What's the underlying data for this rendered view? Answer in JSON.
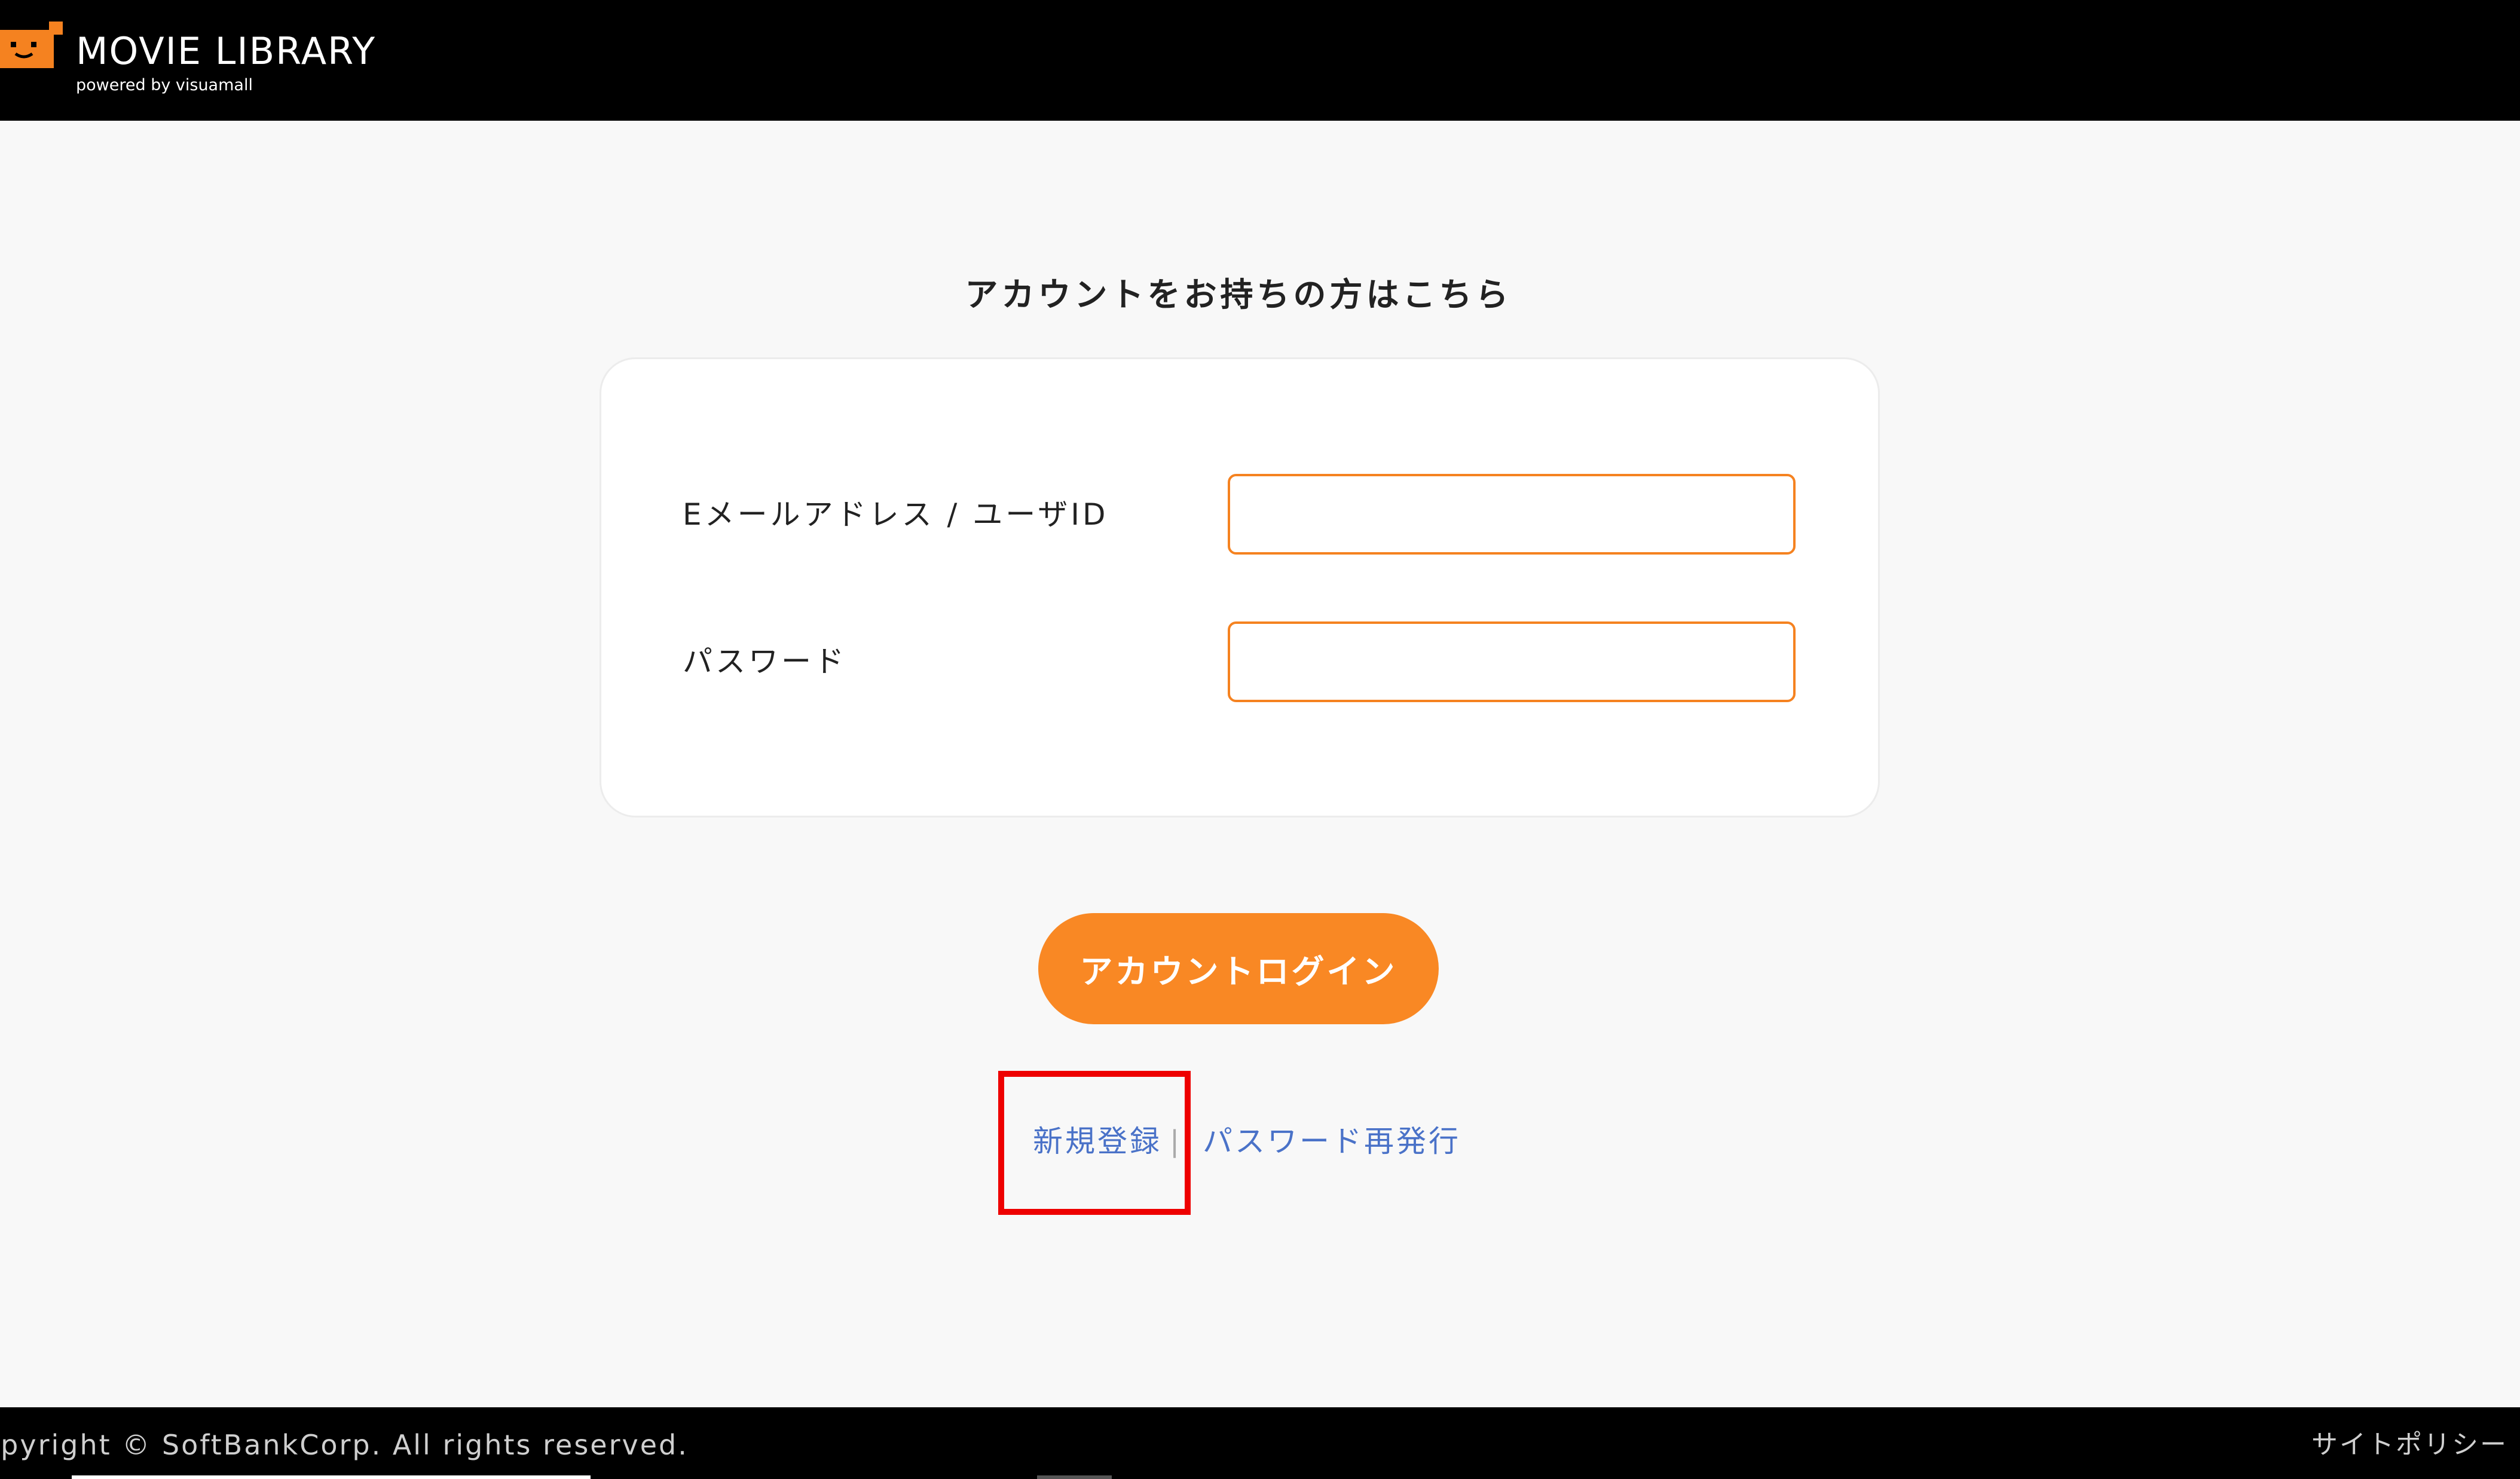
{
  "header": {
    "brand_title": "MOVIE LIBRARY",
    "brand_subtitle": "powered by visuamall",
    "logo_icon": "tv-face-icon",
    "accent_color": "#f58220"
  },
  "login": {
    "heading": "アカウントをお持ちの方はこちら",
    "email_label": "Eメールアドレス / ユーザID",
    "email_value": "",
    "password_label": "パスワード",
    "password_value": "",
    "login_button_label": "アカウントログイン"
  },
  "links": {
    "register_label": "新規登録",
    "separator": "|",
    "reset_password_label": "パスワード再発行",
    "link_color": "#4a72c8"
  },
  "footer": {
    "copyright": "opyright © SoftBankCorp. All rights reserved.",
    "site_policy_label": "サイトポリシー"
  }
}
